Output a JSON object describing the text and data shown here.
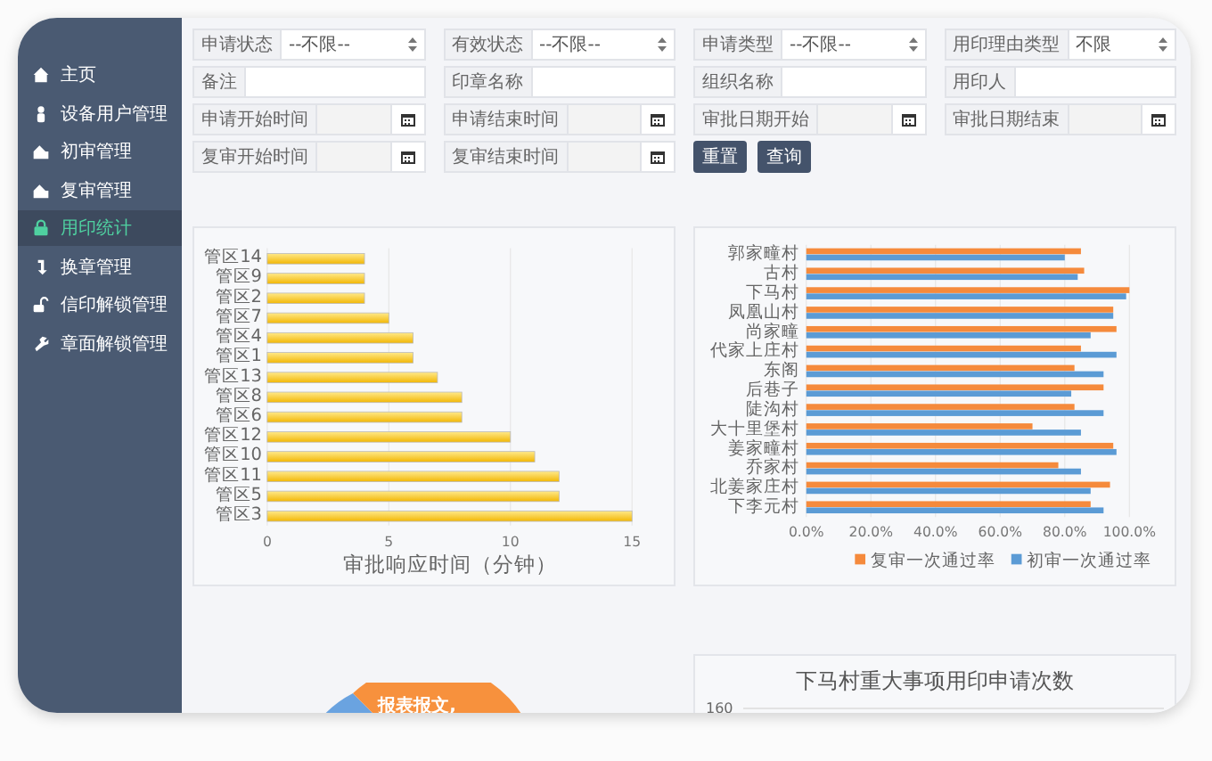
{
  "sidebar": {
    "items": [
      {
        "label": "主页",
        "selected": false
      },
      {
        "label": "设备用户管理",
        "selected": false
      },
      {
        "label": "初审管理",
        "selected": false
      },
      {
        "label": "复审管理",
        "selected": false
      },
      {
        "label": "用印统计",
        "selected": true
      },
      {
        "label": "换章管理",
        "selected": false
      },
      {
        "label": "信印解锁管理",
        "selected": false
      },
      {
        "label": "章面解锁管理",
        "selected": false
      }
    ]
  },
  "filters": [
    {
      "label": "申请状态",
      "kind": "select",
      "value": "--不限--"
    },
    {
      "label": "有效状态",
      "kind": "select",
      "value": "--不限--"
    },
    {
      "label": "申请类型",
      "kind": "select",
      "value": "--不限--"
    },
    {
      "label": "用印理由类型",
      "kind": "select",
      "value": "不限"
    },
    {
      "label": "备注",
      "kind": "text"
    },
    {
      "label": "印章名称",
      "kind": "text"
    },
    {
      "label": "组织名称",
      "kind": "text"
    },
    {
      "label": "用印人",
      "kind": "text"
    },
    {
      "label": "申请开始时间",
      "kind": "date"
    },
    {
      "label": "申请结束时间",
      "kind": "date"
    },
    {
      "label": "审批日期开始",
      "kind": "date"
    },
    {
      "label": "审批日期结束",
      "kind": "date"
    },
    {
      "label": "复审开始时间",
      "kind": "date"
    },
    {
      "label": "复审结束时间",
      "kind": "date"
    }
  ],
  "buttons": [
    "重置",
    "查询"
  ],
  "response_chart": {
    "chart_data": {
      "type": "bar",
      "orientation": "horizontal",
      "xlabel": "审批响应时间（分钟）",
      "categories": [
        "管区14",
        "管区9",
        "管区2",
        "管区7",
        "管区4",
        "管区1",
        "管区13",
        "管区8",
        "管区6",
        "管区12",
        "管区10",
        "管区11",
        "管区5",
        "管区3"
      ],
      "values": [
        4,
        4,
        4,
        5,
        6,
        6,
        7,
        8,
        8,
        10,
        11,
        12,
        12,
        15
      ],
      "xlim": [
        0,
        15
      ],
      "xticks": [
        0,
        5,
        10,
        15
      ],
      "grid": true
    }
  },
  "pass_rate_chart": {
    "chart_data": {
      "type": "bar",
      "orientation": "horizontal",
      "categories": [
        "郭家疃村",
        "古村",
        "下马村",
        "凤凰山村",
        "尚家疃",
        "代家上庄村",
        "东阁",
        "后巷子",
        "陡沟村",
        "大十里堡村",
        "姜家疃村",
        "乔家村",
        "北姜家庄村",
        "下李元村"
      ],
      "series": [
        {
          "name": "复审一次通过率",
          "color": "#f58a3c",
          "values": [
            0.85,
            0.86,
            1.0,
            0.95,
            0.96,
            0.85,
            0.83,
            0.92,
            0.83,
            0.7,
            0.95,
            0.78,
            0.94,
            0.88
          ]
        },
        {
          "name": "初审一次通过率",
          "color": "#5b9bd5",
          "values": [
            0.8,
            0.84,
            0.99,
            0.95,
            0.88,
            0.96,
            0.92,
            0.82,
            0.92,
            0.85,
            0.96,
            0.85,
            0.88,
            0.92
          ]
        }
      ],
      "xlim": [
        0,
        1
      ],
      "xticks": [
        {
          "value": 0,
          "label": "0.0%"
        },
        {
          "value": 0.2,
          "label": "20.0%"
        },
        {
          "value": 0.4,
          "label": "40.0%"
        },
        {
          "value": 0.6,
          "label": "60.0%"
        },
        {
          "value": 0.8,
          "label": "80.0%"
        },
        {
          "value": 1,
          "label": "100.0%"
        }
      ],
      "grid": true,
      "legend": "bottom"
    }
  },
  "pie_chart": {
    "slice_label": "报表报文,"
  },
  "events_chart": {
    "title": "下马村重大事项用印申请次数",
    "tick_label": "160"
  }
}
